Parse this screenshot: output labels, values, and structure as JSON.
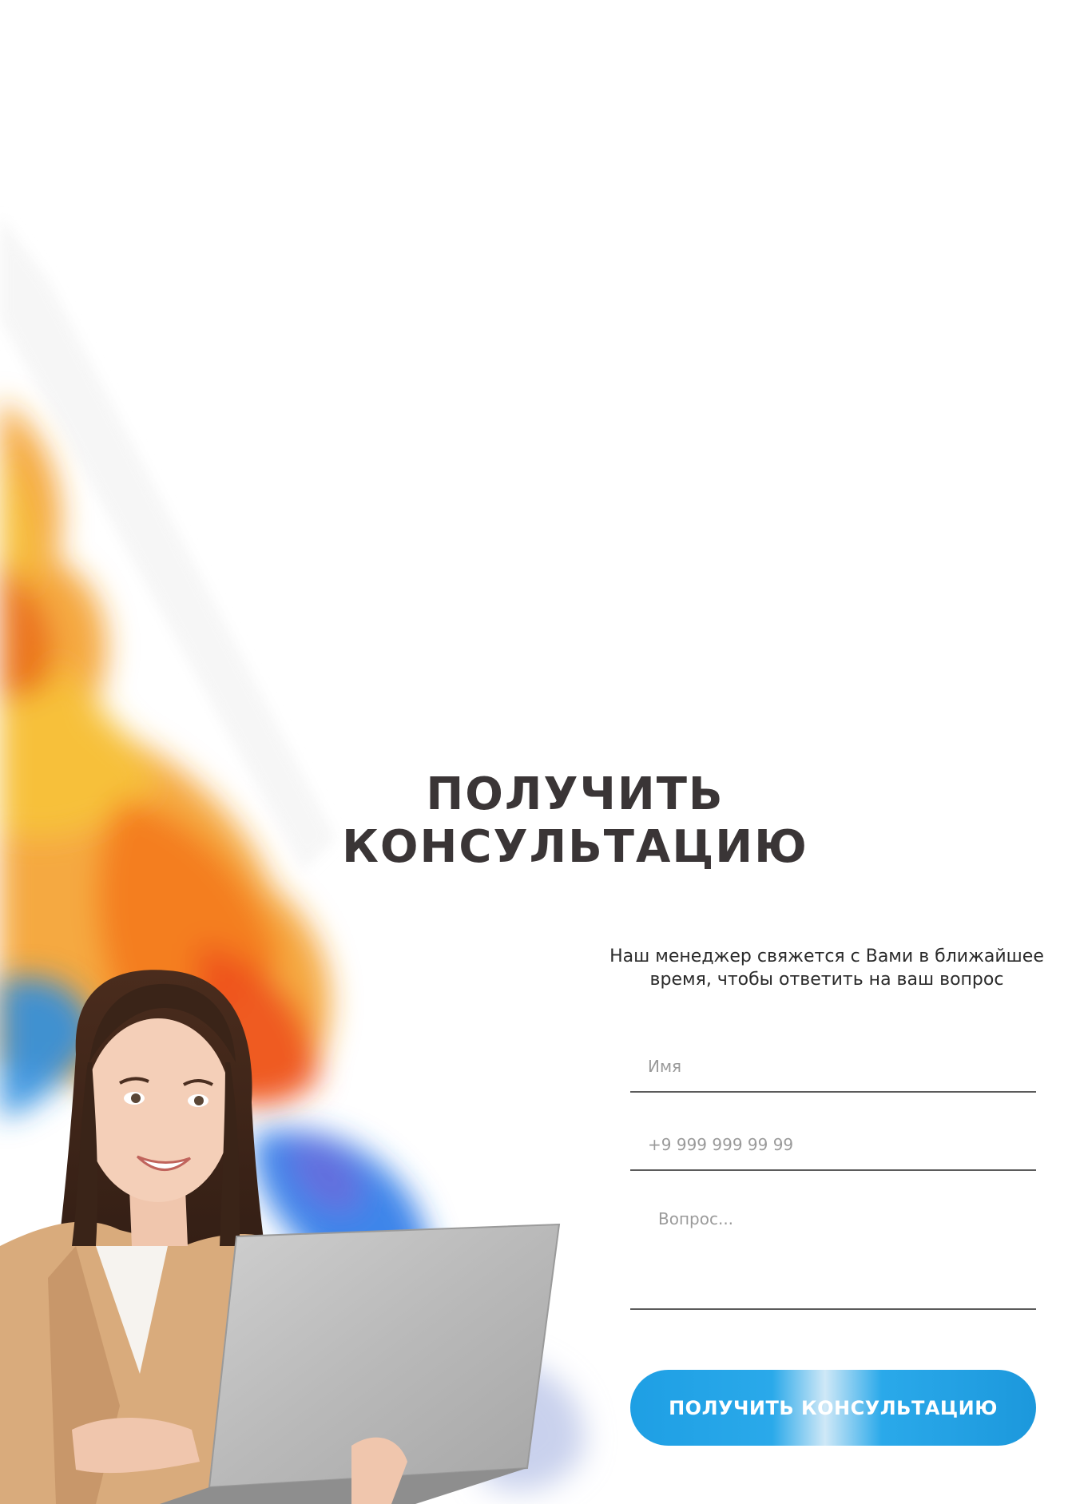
{
  "consult": {
    "title_line1": "ПОЛУЧИТЬ",
    "title_line2": "КОНСУЛЬТАЦИЮ",
    "subtitle_line1": "Наш менеджер свяжется с Вами в ближайшее",
    "subtitle_line2": "время, чтобы ответить на ваш вопрос",
    "name_placeholder": "Имя",
    "phone_placeholder": "+9 999 999 99 99",
    "question_placeholder": "Вопрос...",
    "submit_label": "ПОЛУЧИТЬ КОНСУЛЬТАЦИЮ"
  },
  "colors": {
    "title": "#3a3536",
    "button": "#1e9fe4",
    "underline": "#5b5b5b"
  }
}
